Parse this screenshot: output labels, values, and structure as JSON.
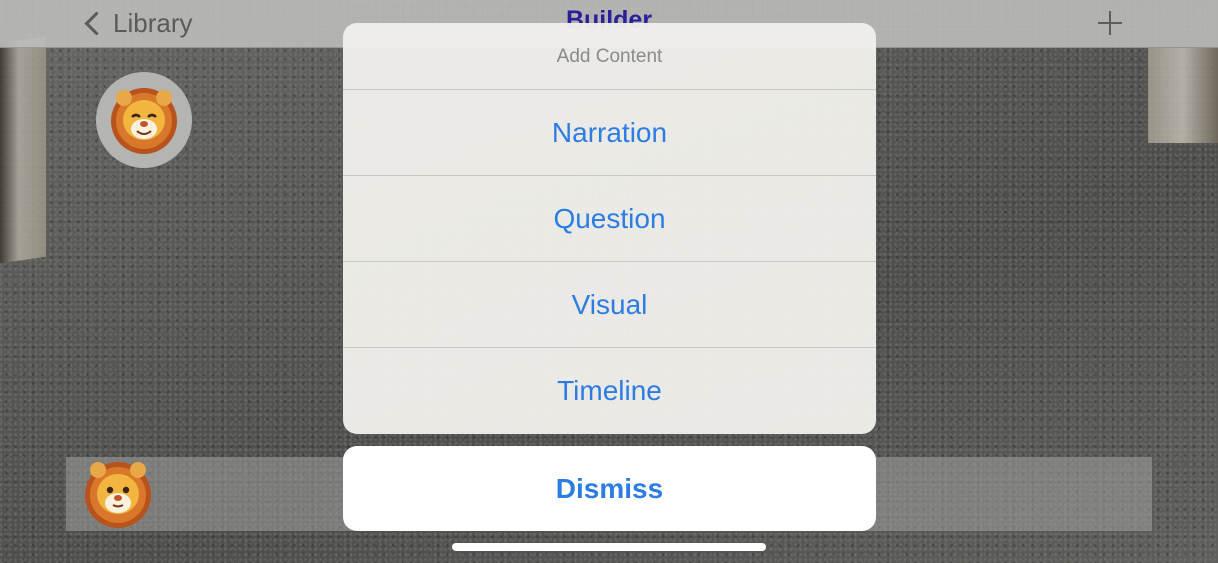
{
  "navbar": {
    "back_label": "Library",
    "title": "Builder",
    "add_icon": "plus-icon"
  },
  "avatar_icon": "lion-memoji-icon",
  "action_sheet": {
    "title": "Add Content",
    "items": [
      {
        "label": "Narration"
      },
      {
        "label": "Question"
      },
      {
        "label": "Visual"
      },
      {
        "label": "Timeline"
      }
    ],
    "dismiss_label": "Dismiss"
  },
  "colors": {
    "accent": "#2b7de3",
    "title_color": "#2a1f9a"
  }
}
